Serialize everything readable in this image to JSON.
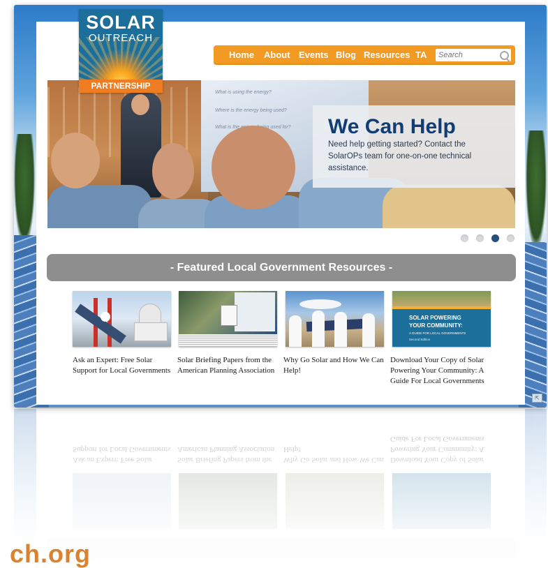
{
  "logo": {
    "line1": "SOLAR",
    "line2": "OUTREACH",
    "line3": "PARTNERSHIP"
  },
  "nav": {
    "items": [
      "Home",
      "About",
      "Events",
      "Blog",
      "Resources",
      "TA"
    ],
    "search_placeholder": "Search"
  },
  "hero": {
    "heading": "We Can Help",
    "body": "Need help getting started? Contact the SolarOPs team for one-on-one technical assistance.",
    "slide_text": [
      "What is using the energy?",
      "Where is the energy being used?",
      "What is the energy being used for?"
    ]
  },
  "slider": {
    "dot_count": 4,
    "active_index": 2
  },
  "featured": {
    "heading": "- Featured Local Government Resources -",
    "cards": [
      {
        "title": "Ask an Expert: Free Solar Support for Local Governments"
      },
      {
        "title": "Solar Briefing Papers from the American Planning Association"
      },
      {
        "title": "Why Go Solar and How We Can Help!"
      },
      {
        "title": "Download Your Copy of Solar Powering Your Community: A Guide For Local Governments"
      }
    ],
    "cover_text": {
      "title_line1": "SOLAR POWERING",
      "title_line2": "YOUR COMMUNITY:",
      "subtitle": "A GUIDE FOR LOCAL GOVERNMENTS",
      "edition": "Second Edition"
    }
  },
  "colors": {
    "nav_orange": "#f39a23",
    "logo_blue": "#1c6f9a",
    "heading_navy": "#123d73",
    "banner_gray": "#8e8e8e",
    "url_orange": "#d98230"
  },
  "footer": {
    "url_fragment": "ch.org"
  }
}
